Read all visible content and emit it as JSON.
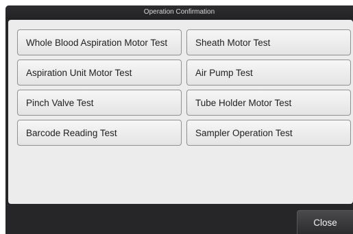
{
  "window": {
    "title": "Operation Confirmation"
  },
  "tests": {
    "left": [
      "Whole Blood Aspiration Motor Test",
      "Aspiration Unit Motor Test",
      "Pinch Valve Test",
      "Barcode Reading Test"
    ],
    "right": [
      "Sheath Motor Test",
      "Air Pump Test",
      "Tube Holder Motor Test",
      "Sampler Operation Test"
    ]
  },
  "footer": {
    "close_label": "Close"
  },
  "colors": {
    "frame": "#262628",
    "panel": "#ececec",
    "button_border": "#8f8f8f",
    "close_button": "#3a3a3c"
  }
}
